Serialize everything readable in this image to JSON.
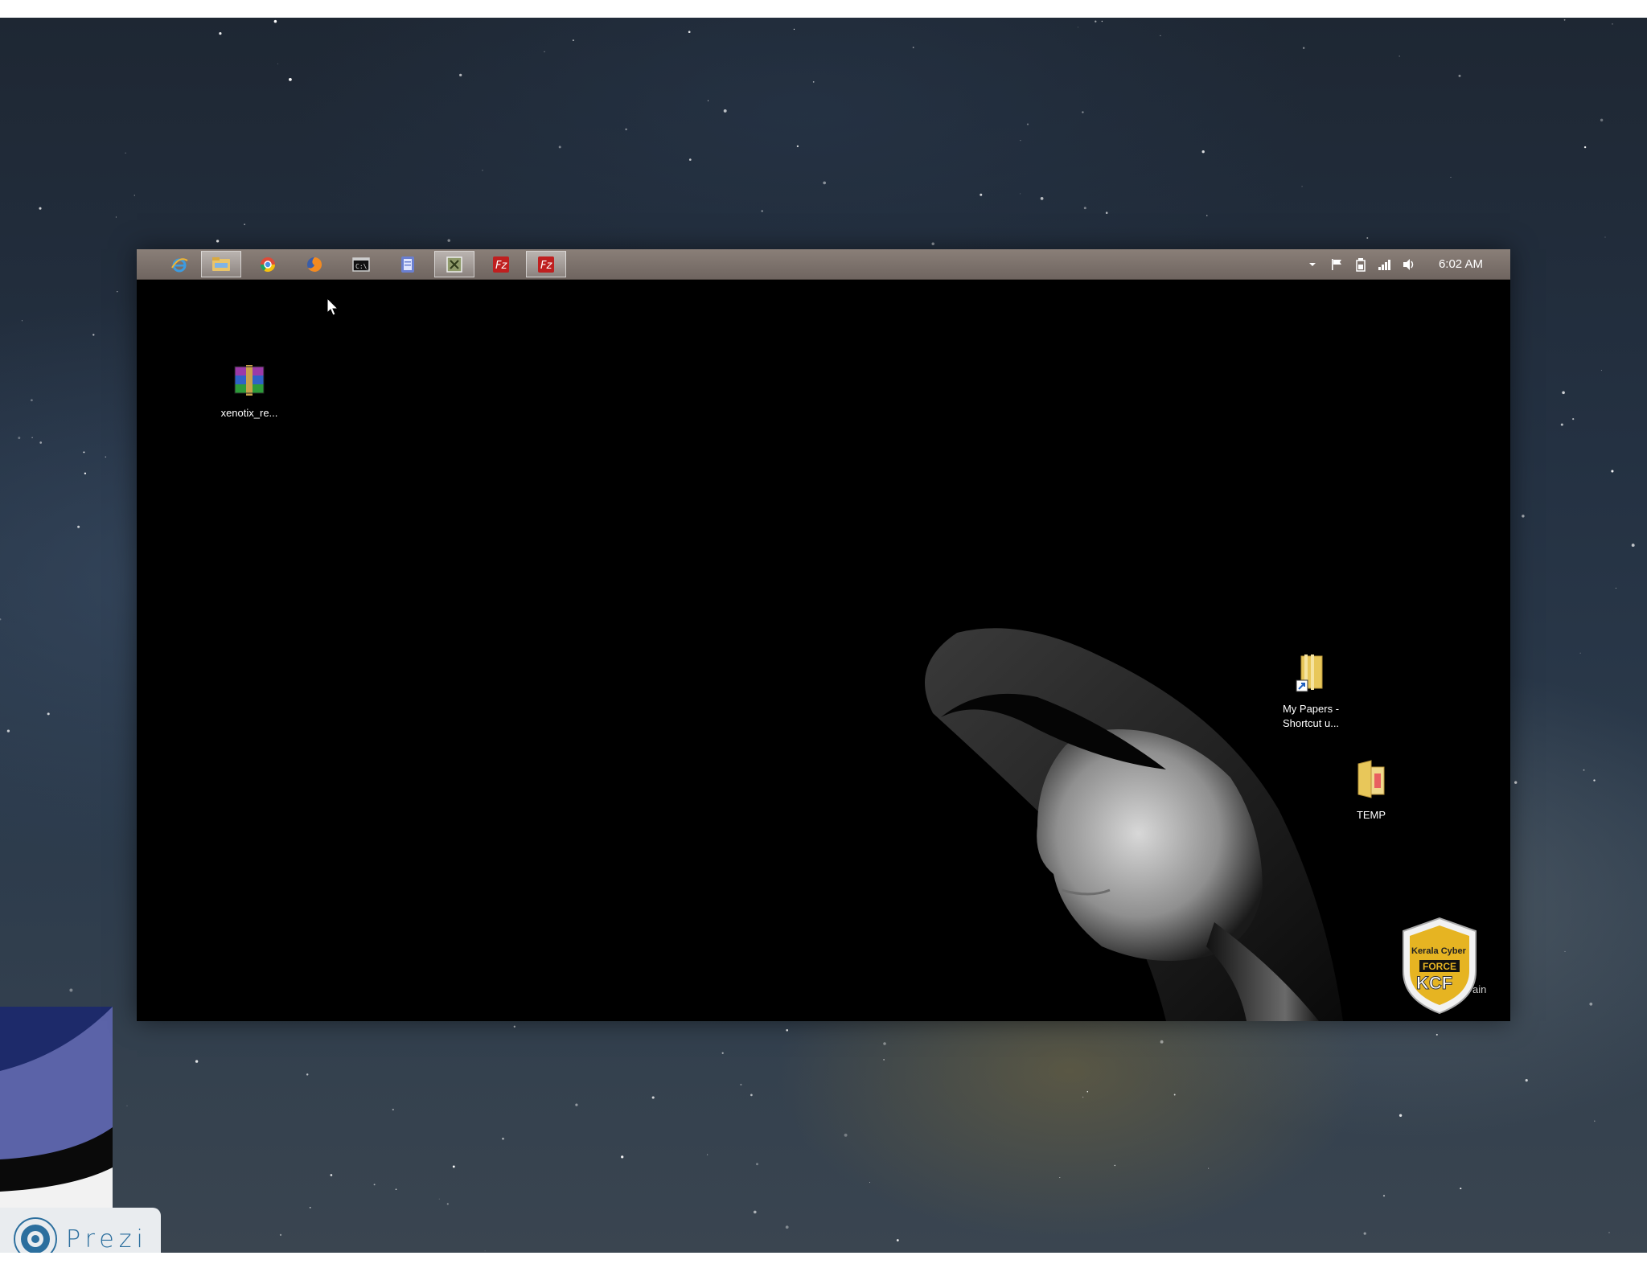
{
  "taskbar": {
    "pinned_apps": [
      {
        "icon": "internet-explorer-icon"
      },
      {
        "icon": "file-explorer-icon"
      },
      {
        "icon": "chrome-icon"
      },
      {
        "icon": "firefox-icon"
      },
      {
        "icon": "command-prompt-icon"
      },
      {
        "icon": "notepad-icon"
      },
      {
        "icon": "app-icon"
      },
      {
        "icon": "filezilla-icon"
      },
      {
        "icon": "filezilla-icon"
      }
    ],
    "tray": {
      "icons": [
        "show-hidden-icons-icon",
        "action-center-flag-icon",
        "power-icon",
        "network-signal-icon",
        "volume-icon"
      ],
      "clock": "6:02 AM"
    }
  },
  "desktop": {
    "icons": [
      {
        "label": "xenotix_re...",
        "icon": "winrar-archive-icon"
      },
      {
        "label": "My Papers -\nShortcut u...",
        "icon": "folder-shortcut-icon"
      },
      {
        "label": "TEMP",
        "icon": "folder-icon"
      }
    ],
    "watermark": {
      "line1": "Kerala Cyber",
      "line2": "FORCE",
      "line3": "KCF",
      "suffix": "ain"
    }
  },
  "prezi": {
    "label": "Prezi"
  },
  "colors": {
    "taskbar": "#7c716b",
    "desktop_bg": "#000000",
    "prezi_blue": "#2c6f9e"
  }
}
